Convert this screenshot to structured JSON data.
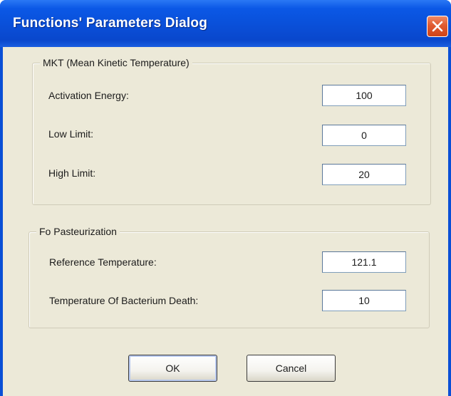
{
  "window": {
    "title": "Functions' Parameters Dialog",
    "close_icon": "close-icon"
  },
  "mkt_group": {
    "legend": "MKT (Mean Kinetic Temperature)",
    "activation_energy": {
      "label": "Activation Energy:",
      "value": "100"
    },
    "low_limit": {
      "label": "Low Limit:",
      "value": "0"
    },
    "high_limit": {
      "label": "High Limit:",
      "value": "20"
    }
  },
  "fo_group": {
    "legend": "Fo Pasteurization",
    "reference_temperature": {
      "label": "Reference Temperature:",
      "value": "121.1"
    },
    "bacterium_death_temperature": {
      "label": "Temperature Of Bacterium Death:",
      "value": "10"
    }
  },
  "buttons": {
    "ok_label": "OK",
    "cancel_label": "Cancel"
  },
  "colors": {
    "titlebar": "#0a4fd6",
    "close_button": "#e05a30",
    "client_background": "#ece9d8"
  }
}
